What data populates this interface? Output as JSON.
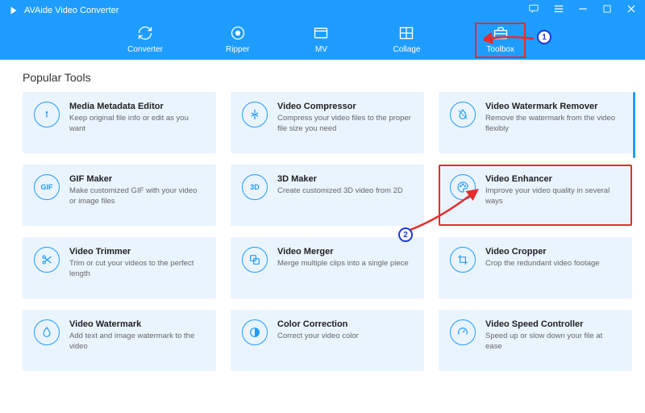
{
  "app_title": "AVAide Video Converter",
  "tabs": {
    "converter": "Converter",
    "ripper": "Ripper",
    "mv": "MV",
    "collage": "Collage",
    "toolbox": "Toolbox"
  },
  "section_title": "Popular Tools",
  "tools": [
    {
      "icon": "info",
      "title": "Media Metadata Editor",
      "desc": "Keep original file info or edit as you want"
    },
    {
      "icon": "compress",
      "title": "Video Compressor",
      "desc": "Compress your video files to the proper file size you need"
    },
    {
      "icon": "droplet",
      "title": "Video Watermark Remover",
      "desc": "Remove the watermark from the video flexibly"
    },
    {
      "icon": "GIF",
      "title": "GIF Maker",
      "desc": "Make customized GIF with your video or image files"
    },
    {
      "icon": "3D",
      "title": "3D Maker",
      "desc": "Create customized 3D video from 2D"
    },
    {
      "icon": "palette",
      "title": "Video Enhancer",
      "desc": "Improve your video quality in several ways"
    },
    {
      "icon": "scissors",
      "title": "Video Trimmer",
      "desc": "Trim or cut your videos to the perfect length"
    },
    {
      "icon": "merge",
      "title": "Video Merger",
      "desc": "Merge multiple clips into a single piece"
    },
    {
      "icon": "crop",
      "title": "Video Cropper",
      "desc": "Crop the redundant video footage"
    },
    {
      "icon": "drop",
      "title": "Video Watermark",
      "desc": "Add text and image watermark to the video"
    },
    {
      "icon": "color",
      "title": "Color Correction",
      "desc": "Correct your video color"
    },
    {
      "icon": "speed",
      "title": "Video Speed Controller",
      "desc": "Speed up or slow down your file at ease"
    }
  ],
  "annotations": {
    "step1": "1",
    "step2": "2"
  }
}
